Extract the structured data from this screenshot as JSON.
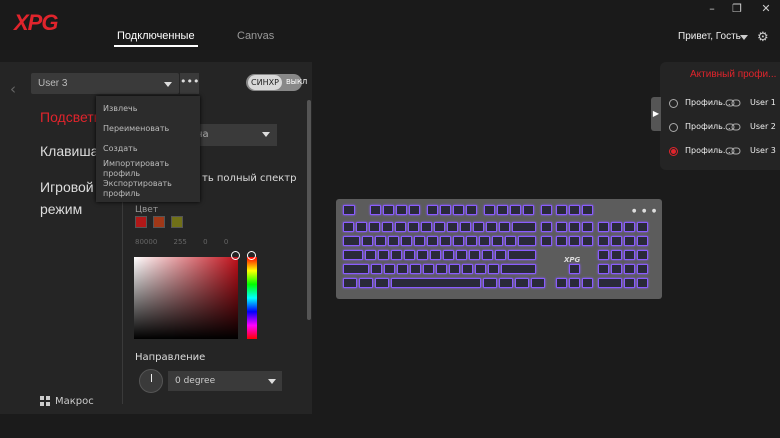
{
  "header": {
    "logo": "XPG",
    "tabs": [
      {
        "label": "Подключенные",
        "active": true
      },
      {
        "label": "Canvas",
        "active": false
      }
    ],
    "window_controls": [
      "–",
      "❐",
      "✕"
    ],
    "user_greeting": "Привет, Гость",
    "settings_icon": "gear-icon"
  },
  "profile_bar": {
    "selected_profile": "User 3",
    "more_label": "•••",
    "sync_on": "СИНХР",
    "sync_off": "ВЫКЛ"
  },
  "profile_menu": {
    "items": [
      "Извлечь",
      "Переименовать",
      "Создать",
      "Импортировать профиль",
      "Экспортировать профиль"
    ]
  },
  "categories": {
    "lighting": "Подсветка",
    "keys": "Клавиша",
    "game_mode": "Игровой режим",
    "macro": "Макрос"
  },
  "lighting": {
    "effect_value_visible": "на",
    "spectrum_label_visible": "ть полный спектр",
    "color_label": "Цвет",
    "swatches": [
      "#b01818",
      "#a03818",
      "#707018"
    ],
    "hex_values": [
      "80000",
      "255",
      "0",
      "0"
    ],
    "direction_label": "Направление",
    "direction_value": "0 degree"
  },
  "active_profiles": {
    "title": "Активный профи...",
    "rows": [
      {
        "name": "Профиль...",
        "user": "User 1",
        "active": false
      },
      {
        "name": "Профиль...",
        "user": "User 2",
        "active": false
      },
      {
        "name": "Профиль...",
        "user": "User 3",
        "active": true
      }
    ]
  },
  "keyboard": {
    "brand": "XPG",
    "accent_color": "#8a5cff"
  },
  "colors": {
    "accent_red": "#e0242c",
    "background": "#1b1b1b",
    "panel": "#252525"
  }
}
